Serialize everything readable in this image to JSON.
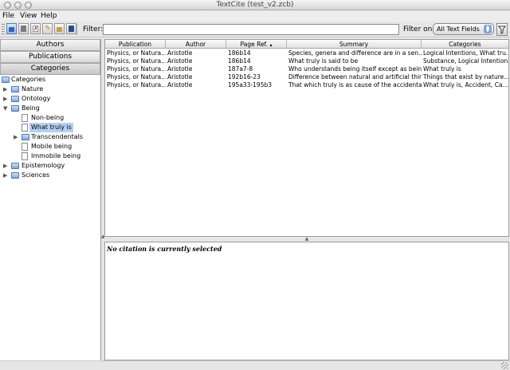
{
  "window": {
    "title": "TextCite (test_v2.zcb)"
  },
  "menu": {
    "file": "File",
    "view": "View",
    "help": "Help"
  },
  "toolbar": {
    "filter_label": "Filter:",
    "filter_value": "",
    "filter_on_label": "Filter on:",
    "filter_on_selected": "All Text Fields",
    "buttons": [
      "open-icon",
      "stop-icon",
      "pdf-icon",
      "edit-icon",
      "import-icon",
      "book-icon"
    ]
  },
  "sidebar": {
    "nav": {
      "authors": "Authors",
      "publications": "Publications",
      "categories": "Categories"
    },
    "tree": {
      "root": "Categories",
      "nature": "Nature",
      "ontology": "Ontology",
      "being": "Being",
      "non_being": "Non-being",
      "what_truly_is": "What truly is",
      "transcendentals": "Transcendentals",
      "mobile_being": "Mobile being",
      "immobile_being": "Immobile being",
      "epistemology": "Epistemology",
      "sciences": "Sciences"
    }
  },
  "table": {
    "columns": [
      "Publication",
      "Author",
      "Page Ref.",
      "Summary",
      "Categories"
    ],
    "sort_indicator": "▴",
    "rows": [
      {
        "publication": "Physics, or Natura...",
        "author": "Aristotle",
        "page": "186b14",
        "summary": "Species, genera and difference are in a sen...",
        "categories": "Logical Intentions, What tru..."
      },
      {
        "publication": "Physics, or Natura...",
        "author": "Aristotle",
        "page": "186b14",
        "summary": "What truly is said to be",
        "categories": "Substance, Logical Intention..."
      },
      {
        "publication": "Physics, or Natura...",
        "author": "Aristotle",
        "page": "187a7-8",
        "summary": "Who understands being itself except as bein...",
        "categories": "What truly is"
      },
      {
        "publication": "Physics, or Natura...",
        "author": "Aristotle",
        "page": "192b16-23",
        "summary": "Difference between natural and artificial thin...",
        "categories": "Things that exist by nature..."
      },
      {
        "publication": "Physics, or Natura...",
        "author": "Aristotle",
        "page": "195a33-195b3",
        "summary": "That which truly is as cause of the accidental",
        "categories": "What truly is, Accident, Ca..."
      }
    ]
  },
  "detail": {
    "message": "No citation is currently selected"
  },
  "colors": {
    "selection": "#b5d1f2",
    "folder": "#7fa7dc",
    "select_arrows": "#7aa2d6"
  }
}
